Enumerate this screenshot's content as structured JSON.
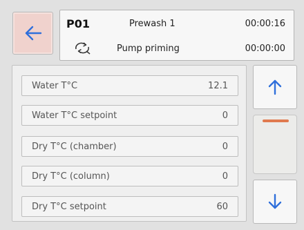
{
  "header": {
    "back_icon": "arrow-left-icon",
    "program_code": "P01",
    "phase_name": "Prewash 1",
    "phase_time": "00:00:16",
    "status_icon": "pump-rotation-icon",
    "status_text": "Pump priming",
    "status_time": "00:00:00"
  },
  "parameters": [
    {
      "label": "Water T°C",
      "value": "12.1"
    },
    {
      "label": "Water T°C setpoint",
      "value": "0"
    },
    {
      "label": "Dry T°C (chamber)",
      "value": "0"
    },
    {
      "label": "Dry T°C (column)",
      "value": "0"
    },
    {
      "label": "Dry T°C setpoint",
      "value": "60"
    }
  ],
  "scroll": {
    "up_icon": "arrow-up-icon",
    "down_icon": "arrow-down-icon",
    "thumb_color": "#e07a4f",
    "position_fraction": 0.0
  },
  "colors": {
    "accent_blue": "#1f5fd6",
    "back_button_bg": "#f0d2cd"
  }
}
